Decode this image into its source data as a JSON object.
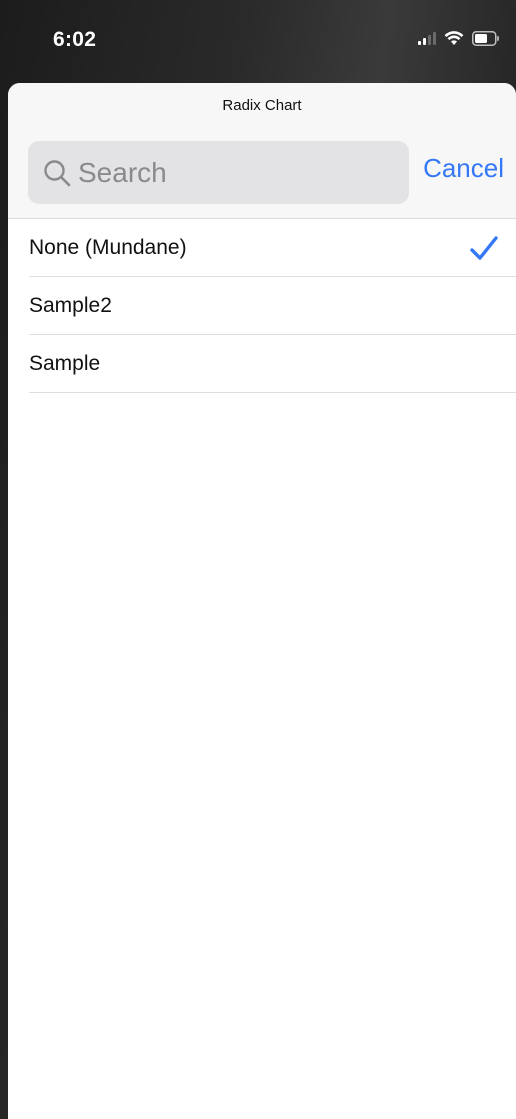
{
  "status_bar": {
    "time": "6:02"
  },
  "sheet": {
    "title": "Radix Chart",
    "search": {
      "placeholder": "Search",
      "value": ""
    },
    "cancel_label": "Cancel",
    "items": [
      {
        "label": "None (Mundane)",
        "selected": true
      },
      {
        "label": "Sample2",
        "selected": false
      },
      {
        "label": "Sample",
        "selected": false
      }
    ]
  },
  "colors": {
    "accent": "#3478f6",
    "sheet_background": "#ffffff",
    "header_background": "#f7f7f8",
    "search_background": "#e3e3e6"
  },
  "icons": {
    "search": "search-icon",
    "checkmark": "checkmark-icon",
    "signal": "signal-icon",
    "wifi": "wifi-icon",
    "battery": "battery-icon"
  }
}
